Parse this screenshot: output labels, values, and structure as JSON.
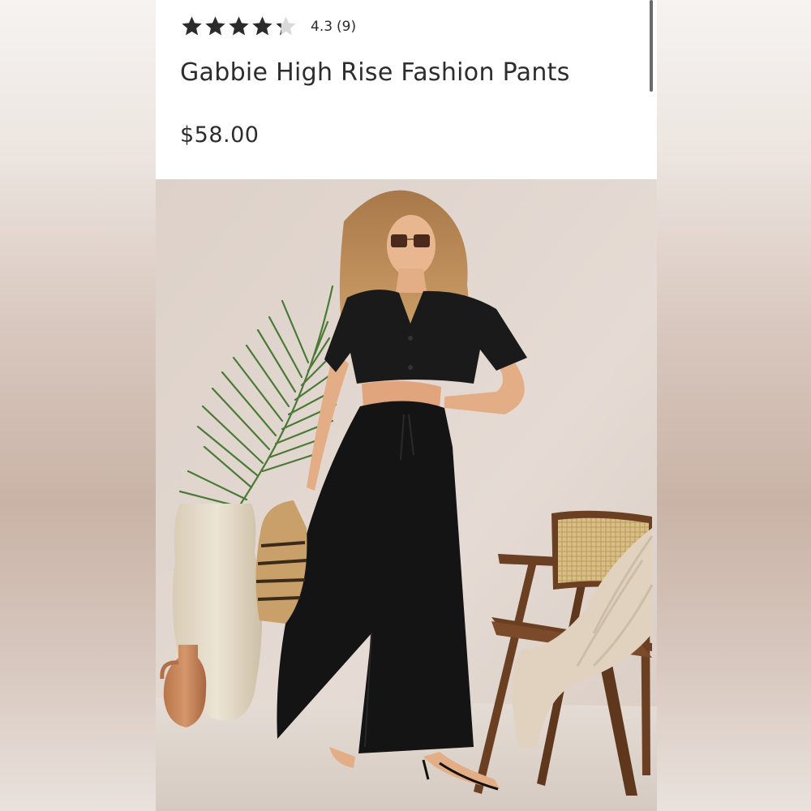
{
  "product": {
    "rating_value": "4.3",
    "rating_count": "(9)",
    "rating_score": 4.3,
    "rating_max": 5,
    "title": "Gabbie High Rise Fashion Pants",
    "price": "$58.00"
  },
  "icons": {
    "star_full": "star-icon",
    "star_partial": "star-half-icon"
  },
  "colors": {
    "text": "#2d2d2d",
    "star": "#2b2b2b",
    "star_empty": "#d9d9d9",
    "background": "#ffffff"
  }
}
